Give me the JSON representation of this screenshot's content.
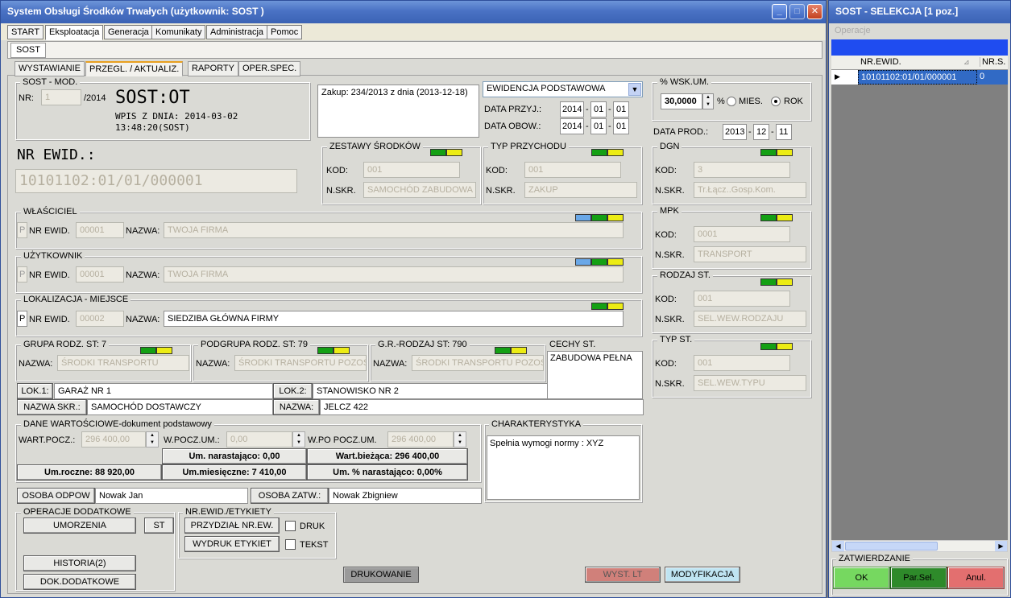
{
  "main_window": {
    "title": "System Obsługi Środków Trwałych  (użytkownik:    SOST    )"
  },
  "menu_tabs": [
    "START",
    "Eksploatacja",
    "Generacja",
    "Komunikaty",
    "Administracja",
    "Pomoc"
  ],
  "module_tab": "SOST",
  "sub_tabs": [
    "WYSTAWIANIE",
    "PRZEGL. / AKTUALIZ.",
    "RAPORTY",
    "OPER.SPEC."
  ],
  "sost_mod": {
    "legend": "SOST - MOD.",
    "nr_label": "NR:",
    "nr_value": "1",
    "year": "/2014",
    "title": "SOST:OT",
    "wpis": "WPIS Z DNIA: 2014-03-02",
    "time": "13:48:20(SOST)"
  },
  "zakup_text": "Zakup:  234/2013 z dnia  (2013-12-18)",
  "ewidencja": {
    "select": "EWIDENCJA PODSTAWOWA",
    "data_przyj_label": "DATA PRZYJ.:",
    "data_przyj": [
      "2014",
      "01",
      "01"
    ],
    "data_obow_label": "DATA OBOW.:",
    "data_obow": [
      "2014",
      "01",
      "01"
    ]
  },
  "wsk_um": {
    "legend": "% WSK.UM.",
    "value": "30,0000",
    "pct": "%",
    "mies": "MIES.",
    "rok": "ROK",
    "selected": "ROK"
  },
  "data_prod": {
    "label": "DATA PROD.:",
    "values": [
      "2013",
      "12",
      "11"
    ]
  },
  "nr_ewid": {
    "label": "NR EWID.:",
    "value": "10101102:01/01/000001"
  },
  "zestawy": {
    "legend": "ZESTAWY ŚRODKÓW",
    "kod_label": "KOD:",
    "kod": "001",
    "nskr_label": "N.SKR.",
    "nskr": "SAMOCHÓD ZABUDOWA"
  },
  "typ_przychodu": {
    "legend": "TYP PRZYCHODU",
    "kod_label": "KOD:",
    "kod": "001",
    "nskr_label": "N.SKR.",
    "nskr": "ZAKUP"
  },
  "dgn": {
    "legend": "DGN",
    "kod_label": "KOD:",
    "kod": "3",
    "nskr_label": "N.SKR.",
    "nskr": "Tr.Łącz..Gosp.Kom."
  },
  "mpk": {
    "legend": "MPK",
    "kod_label": "KOD:",
    "kod": "0001",
    "nskr_label": "N.SKR.",
    "nskr": "TRANSPORT"
  },
  "rodzaj_st": {
    "legend": "RODZAJ ST.",
    "kod_label": "KOD:",
    "kod": "001",
    "nskr_label": "N.SKR.",
    "nskr": "SEL.WEW.RODZAJU"
  },
  "typ_st": {
    "legend": "TYP ST.",
    "kod_label": "KOD:",
    "kod": "001",
    "nskr_label": "N.SKR.",
    "nskr": "SEL.WEW.TYPU"
  },
  "wlasciciel": {
    "legend": "WŁAŚCICIEL",
    "p": "P",
    "nr_label": "NR EWID.",
    "nr": "00001",
    "nazwa_label": "NAZWA:",
    "nazwa": "TWOJA FIRMA"
  },
  "uzytkownik": {
    "legend": "UŻYTKOWNIK",
    "p": "P",
    "nr_label": "NR EWID.",
    "nr": "00001",
    "nazwa_label": "NAZWA:",
    "nazwa": "TWOJA FIRMA"
  },
  "lokalizacja": {
    "legend": "LOKALIZACJA - MIEJSCE",
    "p": "P",
    "nr_label": "NR EWID.",
    "nr": "00002",
    "nazwa_label": "NAZWA:",
    "nazwa": "SIEDZIBA GŁÓWNA FIRMY"
  },
  "grupa": {
    "legend": "GRUPA RODZ. ST: 7",
    "nazwa_label": "NAZWA:",
    "nazwa": "ŚRODKI TRANSPORTU"
  },
  "podgrupa": {
    "legend": "PODGRUPA RODZ. ST: 79",
    "nazwa_label": "NAZWA:",
    "nazwa": "ŚRODKI TRANSPORTU POZOS"
  },
  "gr_rodzaj": {
    "legend": "G.R.-RODZAJ ST: 790",
    "nazwa_label": "NAZWA:",
    "nazwa": "ŚRODKI TRANSPORTU POZOS"
  },
  "cechy": {
    "legend": "CECHY ST.",
    "text": "ZABUDOWA PEŁNA"
  },
  "lok1": {
    "btn": "LOK.1:",
    "value": "GARAŻ NR 1"
  },
  "lok2": {
    "btn": "LOK.2:",
    "value": "STANOWISKO NR 2"
  },
  "nazwa_skr": {
    "btn": "NAZWA SKR.:",
    "value": "SAMOCHÓD DOSTAWCZY"
  },
  "nazwa": {
    "btn": "NAZWA:",
    "value": "JELCZ 422"
  },
  "dane": {
    "legend": "DANE WARTOŚCIOWE-dokument podstawowy",
    "wart_pocz_label": "WART.POCZ.:",
    "wart_pocz": "296 400,00",
    "w_pocz_um_label": "W.POCZ.UM.:",
    "w_pocz_um": "0,00",
    "w_po_label": "W.PO POCZ.UM.",
    "w_po": "296 400,00",
    "um_narast": "Um. narastająco: 0,00",
    "wart_biez": "Wart.bieżąca: 296 400,00",
    "um_roczne": "Um.roczne: 88 920,00",
    "um_mies": "Um.miesięczne: 7 410,00",
    "um_pct": "Um. % narastająco: 0,00%"
  },
  "charakterystyka": {
    "legend": "CHARAKTERYSTYKA",
    "text": "Spełnia wymogi normy : XYZ"
  },
  "osoba_odpow": {
    "btn": "OSOBA ODPOW",
    "value": "Nowak Jan"
  },
  "osoba_zatw": {
    "btn": "OSOBA ZATW.:",
    "value": "Nowak Zbigniew"
  },
  "operacje": {
    "legend": "OPERACJE DODATKOWE",
    "umorzenia": "UMORZENIA",
    "st": "ST",
    "historia": "HISTORIA(2)",
    "dok": "DOK.DODATKOWE"
  },
  "etykiety": {
    "legend": "NR.EWID./ETYKIETY",
    "przydzial": "PRZYDZIAŁ NR.EW.",
    "druk": "DRUK",
    "wydruk": "WYDRUK ETYKIET",
    "tekst": "TEKST"
  },
  "bottom": {
    "drukowanie": "DRUKOWANIE",
    "wyst_lt": "WYST. LT",
    "modyfikacja": "MODYFIKACJA"
  },
  "side": {
    "title": "SOST - SELEKCJA [1 poz.]",
    "operacje": "Operacje",
    "col1": "NR.EWID.",
    "col2": "NR.S.",
    "row_nr": "10101102:01/01/000001",
    "row_s": "0",
    "zatw": "ZATWIERDZANIE",
    "ok": "OK",
    "parsel": "Par.Sel.",
    "anul": "Anul."
  }
}
